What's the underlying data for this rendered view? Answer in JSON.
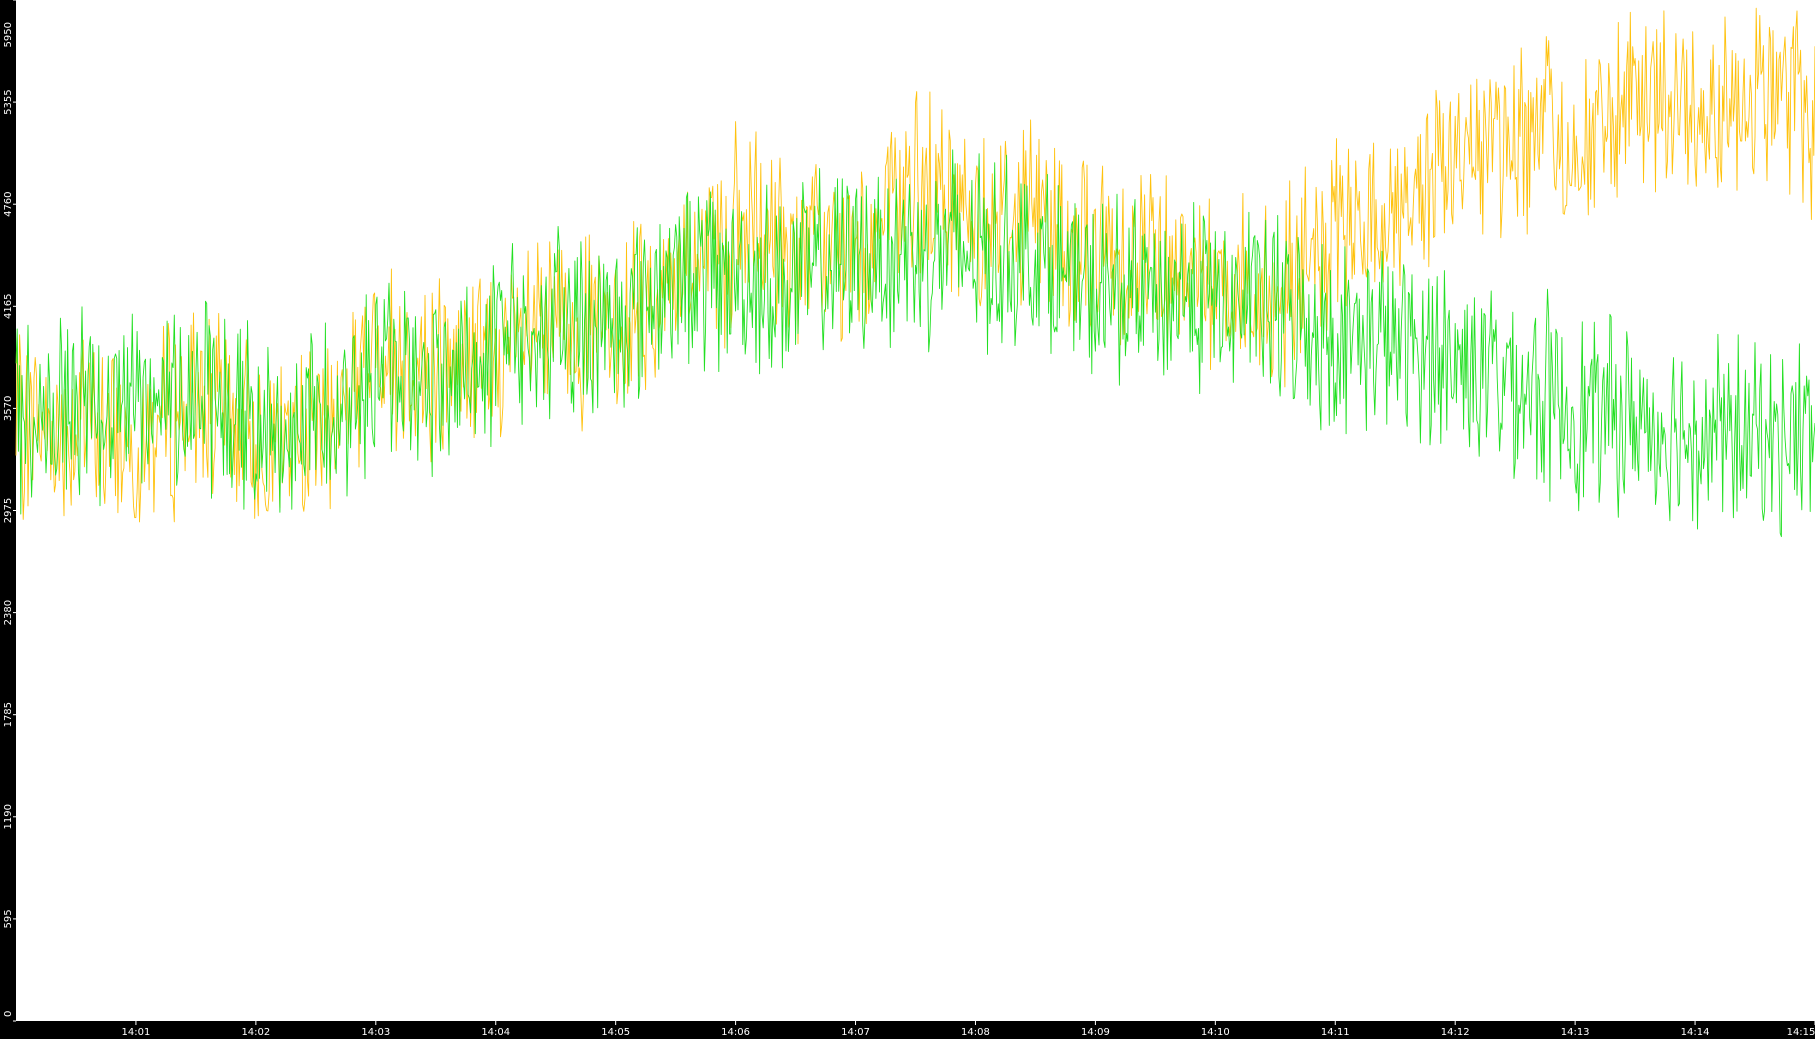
{
  "colors": {
    "background": "#000000",
    "plot_area": "#ffffff",
    "axis_text": "#ffffff",
    "series_1": "#ffc20e",
    "series_2": "#22e022"
  },
  "chart_data": {
    "type": "line",
    "title": "",
    "xlabel": "",
    "ylabel": "",
    "ylim": [
      0,
      5950
    ],
    "y_ticks": [
      "0",
      "595",
      "1190",
      "1785",
      "2380",
      "2975",
      "3570",
      "4165",
      "4760",
      "5355",
      "5950"
    ],
    "xlim": [
      "14:00:00",
      "14:15:00"
    ],
    "x_ticks": [
      "14:01",
      "14:02",
      "14:03",
      "14:04",
      "14:05",
      "14:06",
      "14:07",
      "14:08",
      "14:09",
      "14:10",
      "14:11",
      "14:12",
      "14:13",
      "14:14",
      "14:15"
    ],
    "grid": false,
    "legend": "none",
    "series": [
      {
        "color": "#ffc20e",
        "x": [
          "14:00:00",
          "14:00:30",
          "14:01:00",
          "14:01:30",
          "14:02:00",
          "14:02:30",
          "14:03:00",
          "14:03:30",
          "14:04:00",
          "14:04:30",
          "14:05:00",
          "14:05:30",
          "14:06:00",
          "14:06:30",
          "14:07:00",
          "14:07:30",
          "14:08:00",
          "14:08:30",
          "14:09:00",
          "14:09:30",
          "14:10:00",
          "14:10:30",
          "14:11:00",
          "14:11:30",
          "14:12:00",
          "14:12:30",
          "14:13:00",
          "14:13:30",
          "14:14:00",
          "14:14:30",
          "14:15:00"
        ],
        "values": [
          3500,
          3450,
          3400,
          3600,
          3400,
          3400,
          3900,
          3800,
          3850,
          4050,
          4000,
          4350,
          4600,
          4500,
          4450,
          4850,
          4700,
          4750,
          4450,
          4500,
          4350,
          4200,
          4550,
          4700,
          5050,
          5200,
          5100,
          5300,
          5350,
          5450,
          5300
        ]
      },
      {
        "color": "#22e022",
        "x": [
          "14:00:00",
          "14:00:30",
          "14:01:00",
          "14:01:30",
          "14:02:00",
          "14:02:30",
          "14:03:00",
          "14:03:30",
          "14:04:00",
          "14:04:30",
          "14:05:00",
          "14:05:30",
          "14:06:00",
          "14:06:30",
          "14:07:00",
          "14:07:30",
          "14:08:00",
          "14:08:30",
          "14:09:00",
          "14:09:30",
          "14:10:00",
          "14:10:30",
          "14:11:00",
          "14:11:30",
          "14:12:00",
          "14:12:30",
          "14:13:00",
          "14:13:30",
          "14:14:00",
          "14:14:30",
          "14:15:00"
        ],
        "values": [
          3500,
          3550,
          3650,
          3700,
          3450,
          3500,
          3800,
          3750,
          3900,
          4050,
          4100,
          4350,
          4350,
          4300,
          4450,
          4500,
          4500,
          4450,
          4200,
          4250,
          4200,
          4150,
          4000,
          3950,
          3850,
          3750,
          3550,
          3500,
          3450,
          3400,
          3400
        ]
      }
    ]
  }
}
